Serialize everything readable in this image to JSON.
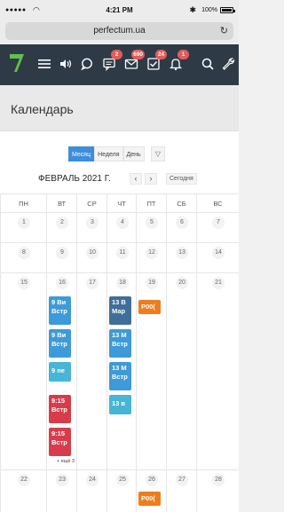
{
  "statusbar": {
    "signal": "●●●●●",
    "time": "4:21 PM",
    "battery": "100%"
  },
  "urlbar": {
    "url": "perfectum.ua"
  },
  "header": {
    "badges": {
      "messages": "2",
      "mail": "690",
      "tasks": "24",
      "notifications": "1"
    }
  },
  "page": {
    "title": "Календарь"
  },
  "calendar": {
    "views": [
      "Месяц",
      "Неделя",
      "День"
    ],
    "active_view": "Месяц",
    "month_title": "ФЕВРАЛЬ 2021 Г.",
    "prev": "‹",
    "next": "›",
    "today": "Сегодня",
    "weekdays": [
      "ПН",
      "ВТ",
      "СР",
      "ЧТ",
      "ПТ",
      "СБ",
      "ВС"
    ],
    "weeks": [
      [
        "1",
        "2",
        "3",
        "4",
        "5",
        "6",
        "7"
      ],
      [
        "8",
        "9",
        "10",
        "11",
        "12",
        "13",
        "14"
      ],
      [
        "15",
        "16",
        "17",
        "18",
        "19",
        "20",
        "21"
      ],
      [
        "22",
        "23",
        "24",
        "25",
        "26",
        "27",
        "28"
      ]
    ],
    "events": {
      "tue16": [
        {
          "l1": "9 Ви",
          "l2": "Встр",
          "color": "#3e9ad9"
        },
        {
          "l1": "9 Ви",
          "l2": "Встр",
          "color": "#3e9ad9"
        },
        {
          "l1": "9 пе",
          "l2": "",
          "color": "#47b5d6"
        },
        {
          "l1": "9:15",
          "l2": "Встр",
          "color": "#d93b4a"
        },
        {
          "l1": "9:15",
          "l2": "Встр",
          "color": "#d93b4a"
        }
      ],
      "tue16_more": "+ ещё 3",
      "thu18": [
        {
          "l1": "13 В",
          "l2": "Мар",
          "color": "#3f6f98"
        },
        {
          "l1": "13 М",
          "l2": "Встр",
          "color": "#3e9ad9"
        },
        {
          "l1": "13 М",
          "l2": "Встр",
          "color": "#3e9ad9"
        },
        {
          "l1": "13 в",
          "l2": "",
          "color": "#47b5d6"
        }
      ],
      "fri19": [
        {
          "l1": "P00(",
          "color": "#f07c1a"
        }
      ],
      "fri26": [
        {
          "l1": "P00(",
          "color": "#f07c1a"
        }
      ]
    }
  }
}
